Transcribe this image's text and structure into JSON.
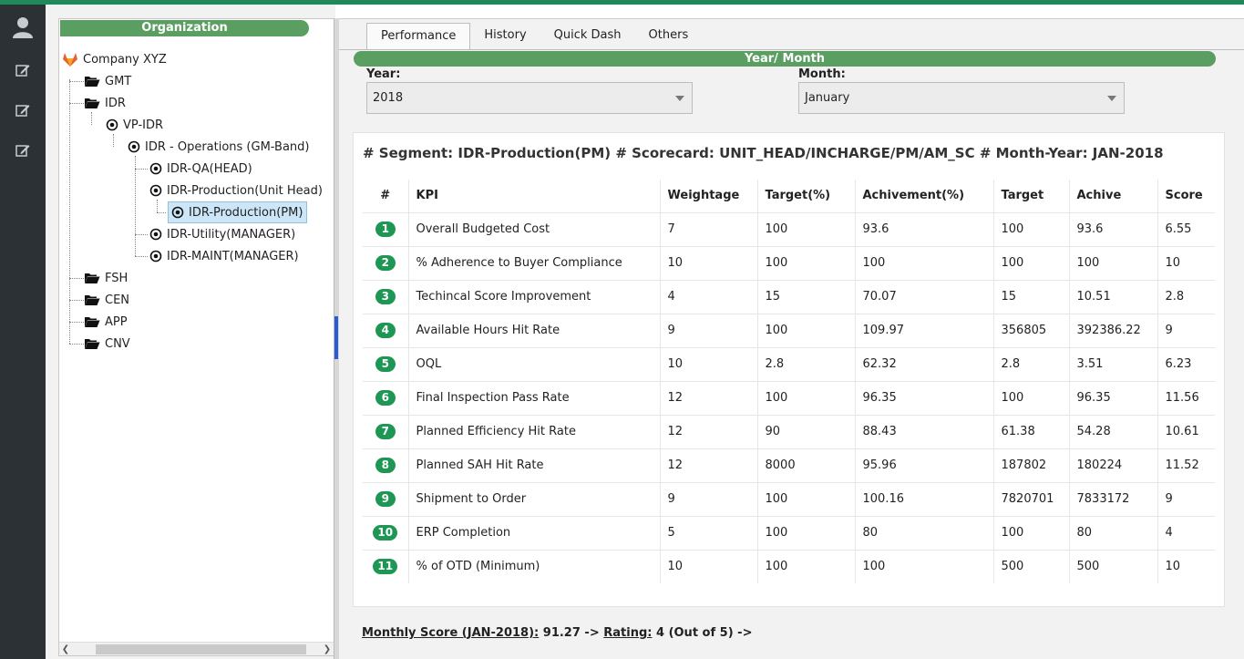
{
  "left_nav": {
    "items": [
      {
        "icon": "user-icon"
      },
      {
        "icon": "edit-icon"
      },
      {
        "icon": "edit-icon"
      },
      {
        "icon": "edit-icon"
      }
    ]
  },
  "tree": {
    "header": "Organization",
    "nodes": {
      "company": "Company XYZ",
      "gmt": "GMT",
      "idr": "IDR",
      "vp_idr": "VP-IDR",
      "idr_ops": "IDR - Operations (GM-Band)",
      "idr_qa": "IDR-QA(HEAD)",
      "idr_prod_unit": "IDR-Production(Unit Head)",
      "idr_prod_pm": "IDR-Production(PM)",
      "idr_utility": "IDR-Utility(MANAGER)",
      "idr_maint": "IDR-MAINT(MANAGER)",
      "fsh": "FSH",
      "cen": "CEN",
      "app": "APP",
      "cnv": "CNV"
    },
    "selected": "IDR-Production(PM)"
  },
  "tabs": [
    "Performance",
    "History",
    "Quick Dash",
    "Others"
  ],
  "active_tab": "Performance",
  "year_month": {
    "header": "Year/ Month",
    "year_label": "Year:",
    "year_value": "2018",
    "month_label": "Month:",
    "month_value": "January"
  },
  "scorecard": {
    "title": "# Segment: IDR-Production(PM) # Scorecard: UNIT_HEAD/INCHARGE/PM/AM_SC # Month-Year: JAN-2018",
    "columns": [
      "#",
      "KPI",
      "Weightage",
      "Target(%)",
      "Achivement(%)",
      "Target",
      "Achive",
      "Score"
    ],
    "rows": [
      [
        "1",
        "Overall Budgeted Cost",
        "7",
        "100",
        "93.6",
        "100",
        "93.6",
        "6.55"
      ],
      [
        "2",
        "% Adherence to Buyer Compliance",
        "10",
        "100",
        "100",
        "100",
        "100",
        "10"
      ],
      [
        "3",
        "Techincal Score Improvement",
        "4",
        "15",
        "70.07",
        "15",
        "10.51",
        "2.8"
      ],
      [
        "4",
        "Available Hours Hit Rate",
        "9",
        "100",
        "109.97",
        "356805",
        "392386.22",
        "9"
      ],
      [
        "5",
        "OQL",
        "10",
        "2.8",
        "62.32",
        "2.8",
        "3.51",
        "6.23"
      ],
      [
        "6",
        "Final Inspection Pass Rate",
        "12",
        "100",
        "96.35",
        "100",
        "96.35",
        "11.56"
      ],
      [
        "7",
        "Planned Efficiency Hit Rate",
        "12",
        "90",
        "88.43",
        "61.38",
        "54.28",
        "10.61"
      ],
      [
        "8",
        "Planned SAH Hit Rate",
        "12",
        "8000",
        "95.96",
        "187802",
        "180224",
        "11.52"
      ],
      [
        "9",
        "Shipment to Order",
        "9",
        "100",
        "100.16",
        "7820701",
        "7833172",
        "9"
      ],
      [
        "10",
        "ERP Completion",
        "5",
        "100",
        "80",
        "100",
        "80",
        "4"
      ],
      [
        "11",
        "% of OTD (Minimum)",
        "10",
        "100",
        "100",
        "500",
        "500",
        "10"
      ]
    ]
  },
  "summary": {
    "score_label": "Monthly Score (JAN-2018):",
    "score_value": " 91.27 -> ",
    "rating_label": "Rating:",
    "rating_value": " 4 (Out of 5) ->"
  },
  "colors": {
    "accent_green": "#5a9e62",
    "badge_green": "#1e9654",
    "top_bar": "#1e8a5a",
    "sidebar_bg": "#2b3134"
  }
}
